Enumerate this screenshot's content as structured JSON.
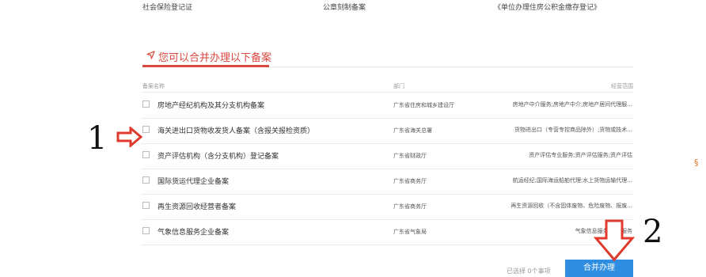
{
  "top_items": [
    {
      "label": "社会保险登记证"
    },
    {
      "label": "公章刻制备案"
    },
    {
      "label": "《单位办理住房公积金缴存登记》"
    }
  ],
  "section": {
    "title": "您可以合并办理以下备案",
    "icon": "send-icon"
  },
  "table": {
    "headers": {
      "name": "备案名称",
      "dept": "部门",
      "scope": "经营范围"
    },
    "rows": [
      {
        "name": "房地产经纪机构及其分支机构备案",
        "dept": "广东省住房和城乡建设厅",
        "scope": "房地产中介服务;房地产中介;房地产居间代理服...",
        "checked": false
      },
      {
        "name": "海关进出口货物收发货人备案（含报关报检资质）",
        "dept": "广东省海关总署",
        "scope": "货物进出口（专营专控商品除外）;货物或技术...",
        "checked": false
      },
      {
        "name": "资产评估机构（含分支机构）登记备案",
        "dept": "广东省财政厅",
        "scope": "资产评估专业服务;资产评估服务;资产评估",
        "checked": false
      },
      {
        "name": "国际货运代理企业备案",
        "dept": "广东省商务厅",
        "scope": "航运经纪;国际海运船舶代理;水上货物运输代理...",
        "checked": false
      },
      {
        "name": "再生资源回收经营者备案",
        "dept": "广东省商务厅",
        "scope": "再生资源回收（不含固体废物、危险废物、报废...",
        "checked": false
      },
      {
        "name": "气象信息服务企业备案",
        "dept": "广东省气象局",
        "scope": "气象信息服务;气象服务",
        "checked": false
      }
    ]
  },
  "footer": {
    "selected_text": "已选择 0个事项",
    "merge_button": "合并办理"
  },
  "annotations": {
    "label1": "1",
    "label2": "2",
    "arrow_color": "#e03a2f"
  },
  "side_glyph": "§",
  "colors": {
    "accent_red": "#d9473f",
    "button_blue": "#2f8ee0"
  }
}
